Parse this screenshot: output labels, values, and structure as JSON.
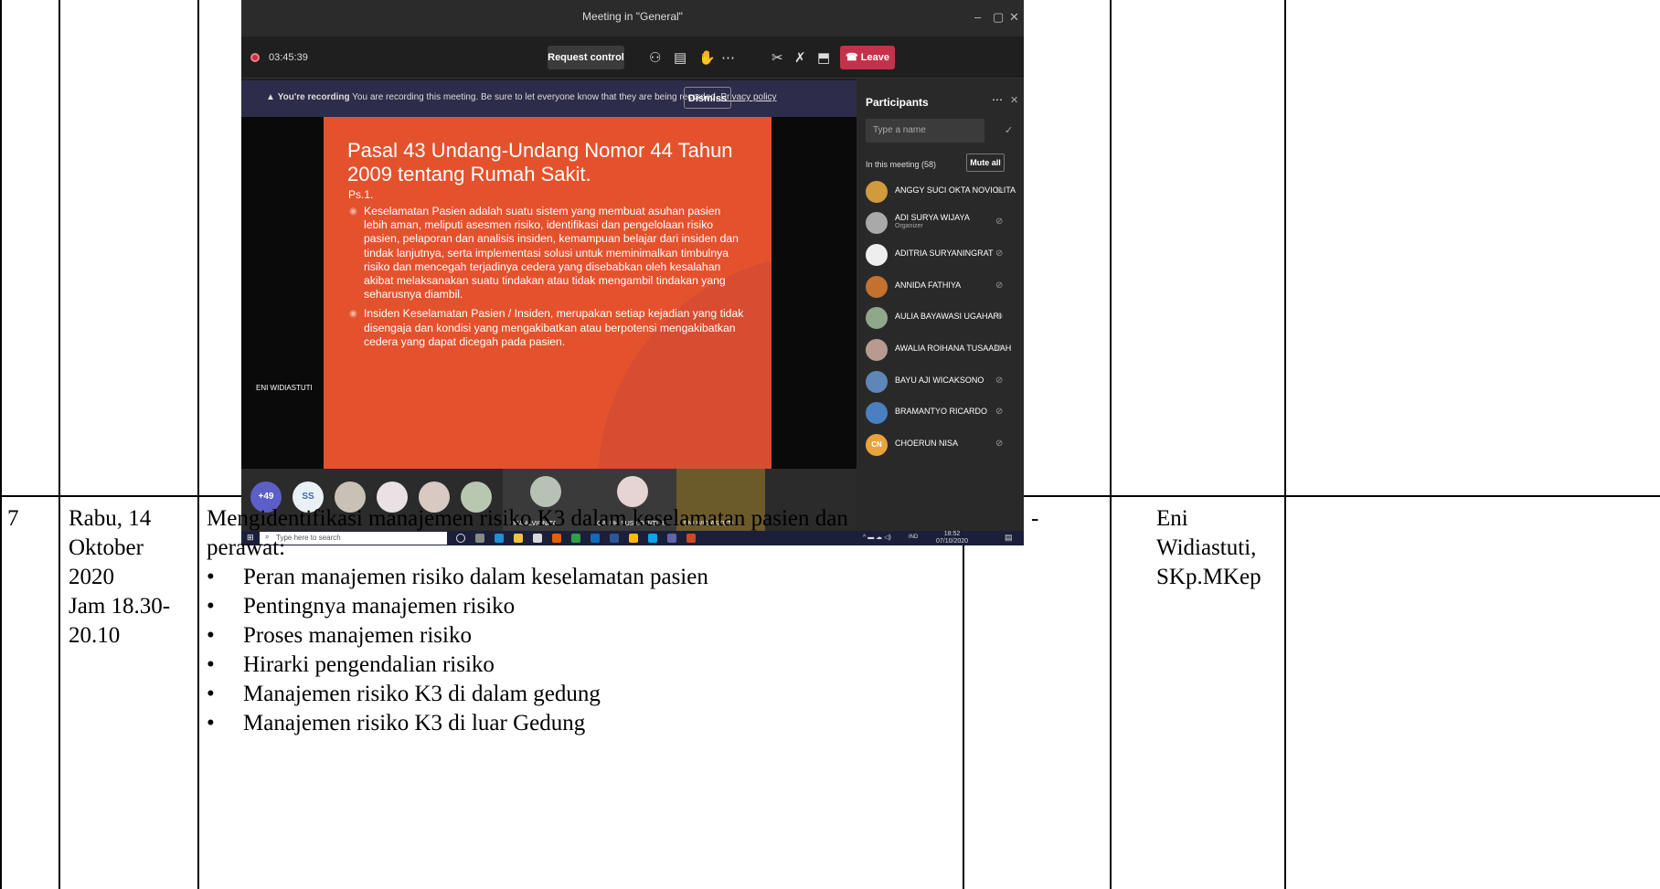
{
  "teams": {
    "window_title": "Meeting in \"General\"",
    "window_controls": [
      "–",
      "▢",
      "✕"
    ],
    "timer": "03:45:39",
    "request_control_label": "Request control",
    "leave_label": "Leave",
    "recording_banner": {
      "strong": "You're recording",
      "message": "You are recording this meeting. Be sure to let everyone know that they are being recorded.",
      "link": "Privacy policy",
      "dismiss_label": "Dismiss"
    },
    "slide": {
      "title": "Pasal 43 Undang-Undang Nomor 44 Tahun 2009 tentang Rumah Sakit.",
      "subtitle": "Ps.1.",
      "bullets": [
        "Keselamatan Pasien adalah suatu sistem yang membuat asuhan pasien lebih aman, meliputi asesmen risiko, identifikasi dan pengelolaan risiko pasien, pelaporan dan analisis insiden, kemampuan belajar dari insiden dan tindak lanjutnya, serta implementasi solusi untuk meminimalkan timbulnya risiko dan mencegah terjadinya cedera yang disebabkan oleh kesalahan akibat melaksanakan suatu tindakan atau tidak mengambil tindakan yang seharusnya diambil.",
        "Insiden Keselamatan Pasien / Insiden, merupakan setiap kejadian yang tidak disengaja dan kondisi yang mengakibatkan atau berpotensi mengakibatkan cedera yang dapat dicegah pada pasien."
      ]
    },
    "speaker_name": "ENI WIDIASTUTI",
    "strip": {
      "overflow_count": "+49",
      "initials": "SS",
      "tiles": [
        "DEA ALVIONITA",
        "GALUH SUSILO INTI R...",
        "ENI WIDIASTUTI"
      ]
    },
    "participants": {
      "title": "Participants",
      "search_placeholder": "Type a name",
      "section": "In this meeting (58)",
      "mute_all_label": "Mute all",
      "people": [
        {
          "name": "ANGGY SUCI OKTA NOVIOLITA",
          "role": ""
        },
        {
          "name": "ADI SURYA WIJAYA",
          "role": "Organizer"
        },
        {
          "name": "ADITRIA SURYANINGRAT",
          "role": ""
        },
        {
          "name": "ANNIDA FATHIYA",
          "role": ""
        },
        {
          "name": "AULIA BAYAWASI UGAHARI",
          "role": ""
        },
        {
          "name": "AWALIA ROIHANA TUSAADAH",
          "role": ""
        },
        {
          "name": "BAYU AJI WICAKSONO",
          "role": ""
        },
        {
          "name": "BRAMANTYO RICARDO",
          "role": ""
        },
        {
          "name": "CHOERUN NISA",
          "role": "",
          "initials": "CN"
        }
      ]
    },
    "taskbar": {
      "search_placeholder": "Type here to search",
      "lang": "IND",
      "time": "18:52",
      "date": "07/10/2020"
    }
  },
  "row": {
    "number": "7",
    "date_lines": [
      "Rabu, 14",
      "Oktober",
      "2020",
      "Jam 18.30-",
      "20.10"
    ],
    "activity_intro": "Mengidentifikasi   manajemen risiko K3 dalam keselamatan pasien dan",
    "activity_intro2": "perawat:",
    "activity_items": [
      "Peran manajemen risiko dalam keselamatan pasien",
      "Pentingnya manajemen risiko",
      "Proses manajemen risiko",
      "Hirarki pengendalian risiko",
      "Manajemen risiko K3 di dalam gedung",
      "Manajemen risiko K3 di luar Gedung"
    ],
    "col4": "-",
    "pic_lines": [
      "Eni",
      "Widiastuti,",
      "SKp.MKep"
    ]
  }
}
